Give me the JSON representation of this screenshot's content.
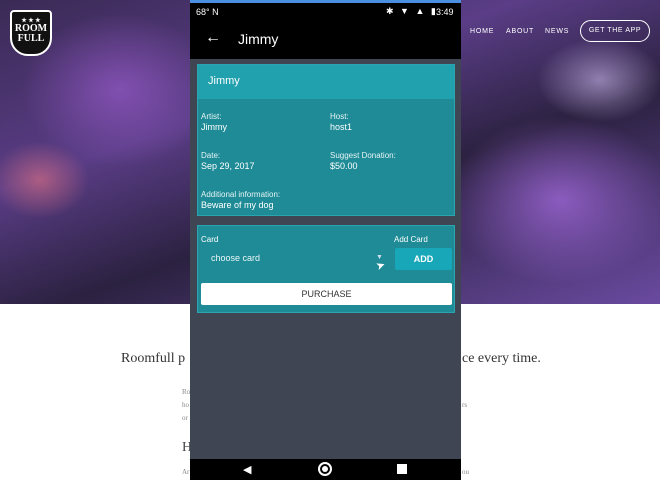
{
  "website": {
    "logo_text": [
      "ROOM",
      "FULL"
    ],
    "logo_stars": "★ ★ ★",
    "nav": {
      "home": "HOME",
      "about": "ABOUT",
      "news": "NEWS"
    },
    "cta": "GET THE APP",
    "tagline_left": "Roomfull p",
    "tagline_right": "ce every time.",
    "faint_bits": [
      "Ro",
      "ho",
      "or",
      "rs",
      "Ar",
      "ou"
    ],
    "heading_fragment": "H"
  },
  "status_bar": {
    "left": "68° N",
    "icons": "✱ ▼ ▲ ▮",
    "time": "3:49"
  },
  "app_bar": {
    "back_icon": "arrow-left-icon",
    "title": "Jimmy"
  },
  "event": {
    "header": "Jimmy",
    "artist_label": "Artist:",
    "artist_value": "Jimmy",
    "host_label": "Host:",
    "host_value": "host1",
    "date_label": "Date:",
    "date_value": "Sep 29, 2017",
    "donation_label": "Suggest Donation:",
    "donation_value": "$50.00",
    "info_label": "Additional information:",
    "info_value": "Beware of my dog"
  },
  "payment": {
    "card_label": "Card",
    "card_placeholder": "choose card",
    "add_card_label": "Add Card",
    "add_button": "ADD",
    "purchase_button": "PURCHASE"
  },
  "colors": {
    "card_bg": "#1e8b96",
    "card_header": "#21a0ae",
    "add_button": "#17a7b8",
    "phone_bg": "#3f4552",
    "status_accent": "#4a8fe0"
  }
}
